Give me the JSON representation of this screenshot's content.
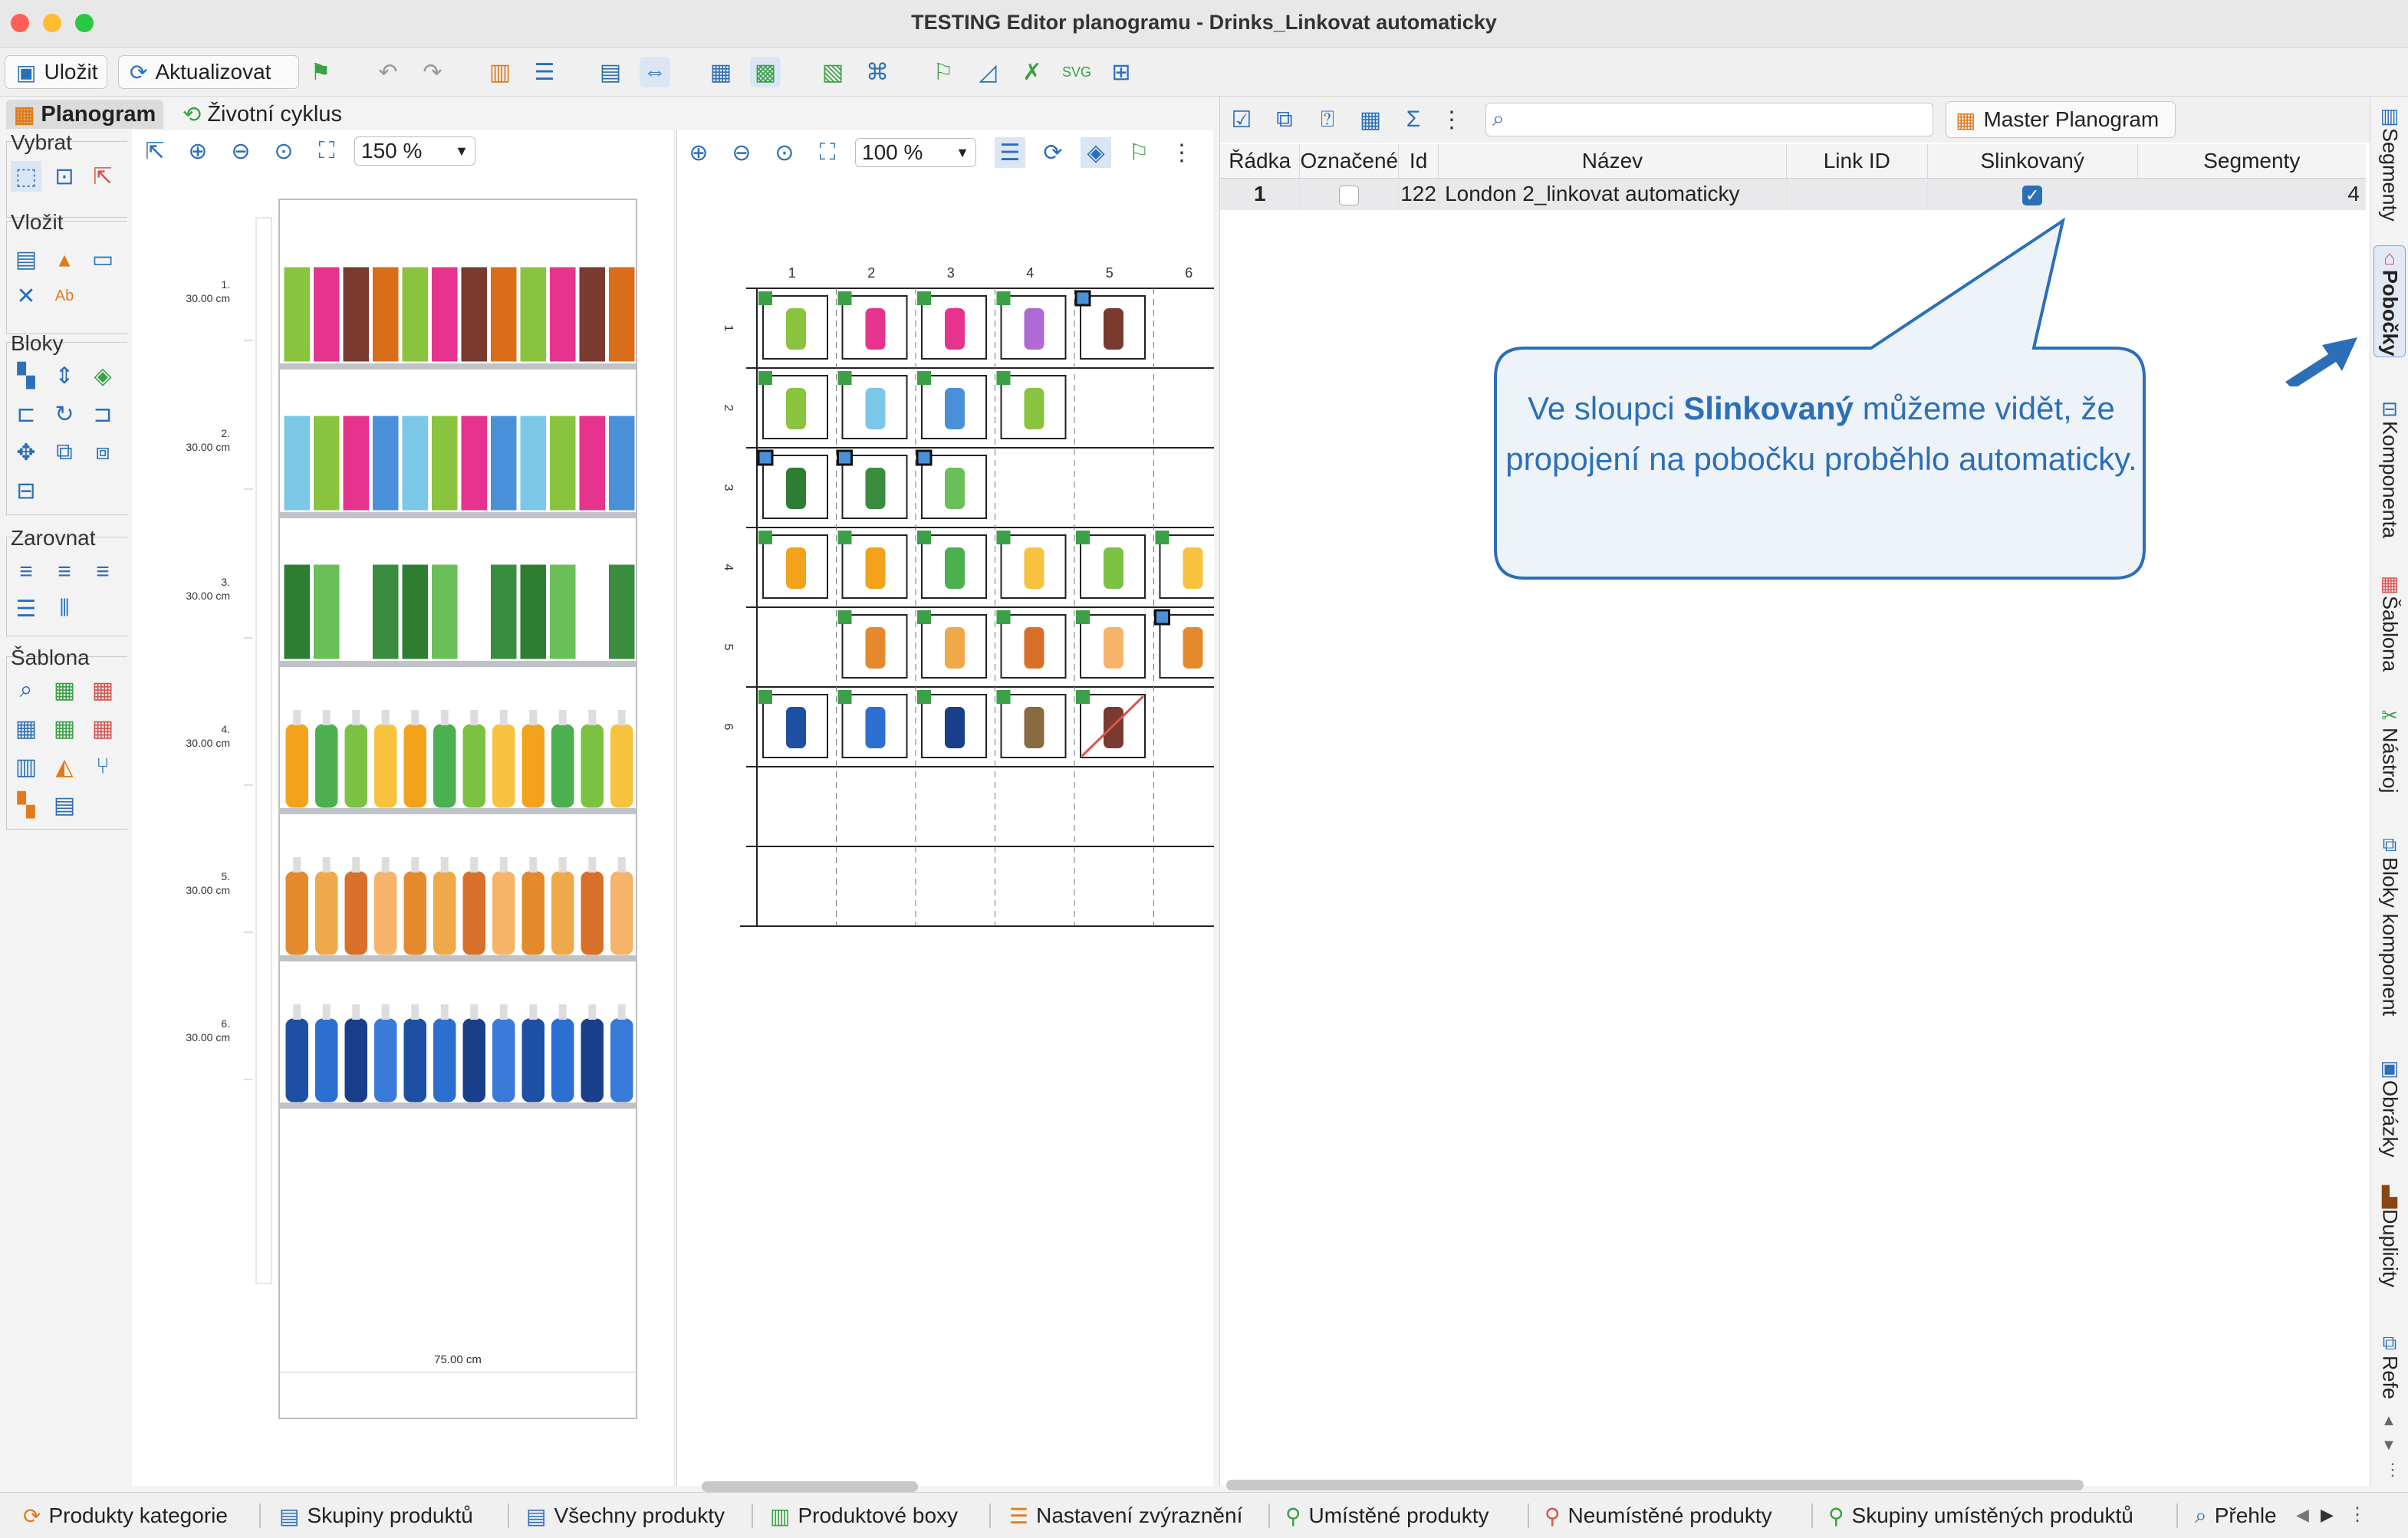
{
  "window": {
    "title": "TESTING Editor planogramu - Drinks_Linkovat automaticky"
  },
  "toolbar": {
    "save_label": "Uložit",
    "refresh_label": "Aktualizovat"
  },
  "tabs": {
    "planogram": "Planogram",
    "lifecycle": "Životní cyklus"
  },
  "leftpanel": {
    "select": "Vybrat",
    "insert": "Vložit",
    "blocks": "Bloky",
    "align": "Zarovnat",
    "template": "Šablona"
  },
  "planogram_view": {
    "zoom": "150 %",
    "shelves": [
      {
        "label": "1.",
        "height": "30.00 cm"
      },
      {
        "label": "2.",
        "height": "30.00 cm"
      },
      {
        "label": "3.",
        "height": "30.00 cm"
      },
      {
        "label": "4.",
        "height": "30.00 cm"
      },
      {
        "label": "5.",
        "height": "30.00 cm"
      },
      {
        "label": "6.",
        "height": "30.00 cm"
      }
    ],
    "width_label": "75.00 cm"
  },
  "grid_view": {
    "zoom": "100 %",
    "columns": [
      "1",
      "2",
      "3",
      "4",
      "5",
      "6"
    ],
    "rows": [
      "1",
      "2",
      "3",
      "4",
      "5",
      "6"
    ]
  },
  "table": {
    "master_label": "Master Planogram",
    "search_placeholder": "",
    "headers": {
      "row": "Řádka",
      "marked": "Označené",
      "id": "Id",
      "name": "Název",
      "link_id": "Link ID",
      "linked": "Slinkovaný",
      "segments": "Segmenty"
    },
    "rows": [
      {
        "row": "1",
        "id": "122",
        "name": "London 2_linkovat automaticky",
        "link_id": "",
        "segments": "4",
        "marked": false,
        "linked": true
      }
    ]
  },
  "callout": {
    "text_before": "Ve sloupci ",
    "text_bold": "Slinkovaný",
    "text_after": " můžeme vidět, že propojení na pobočku proběhlo automaticky."
  },
  "sidebar": {
    "segments": "Segmenty",
    "branches": "Pobočky",
    "component": "Komponenta",
    "template": "Šablona",
    "tool": "Nástroj",
    "component_blocks": "Bloky komponent",
    "images": "Obrázky",
    "duplicates": "Duplicity",
    "refe": "Refe"
  },
  "bottombar": {
    "tabs": [
      "Produkty kategorie",
      "Skupiny produktů",
      "Všechny produkty",
      "Produktové boxy",
      "Nastavení zvýraznění",
      "Umístěné produkty",
      "Neumístěné produkty",
      "Skupiny umístěných produktů",
      "Přehle"
    ]
  },
  "colors": {
    "accent": "#2c6fb7",
    "callout_border": "#2c6fb7",
    "callout_fill": "#eef3fa",
    "green_marker": "#3aa146",
    "blue_marker": "#4a90d9"
  }
}
